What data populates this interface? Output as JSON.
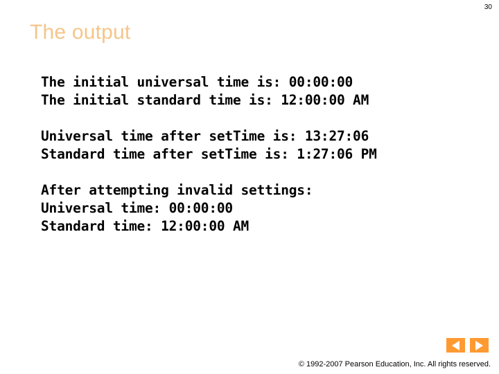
{
  "slide": {
    "number": "30",
    "title": "The output",
    "copyright": "© 1992-2007 Pearson Education, Inc. All rights reserved.",
    "accent_color": "#ff9a33",
    "title_color": "#f5c58a"
  },
  "output": {
    "blocks": [
      {
        "lines": [
          "The initial universal time is: 00:00:00",
          "The initial standard time is: 12:00:00 AM"
        ]
      },
      {
        "lines": [
          "Universal time after setTime is: 13:27:06",
          "Standard time after setTime is: 1:27:06 PM"
        ]
      },
      {
        "lines": [
          "After attempting invalid settings:",
          "Universal time: 00:00:00",
          "Standard time: 12:00:00 AM"
        ]
      }
    ]
  },
  "nav": {
    "prev_label": "prev-arrow",
    "next_label": "next-arrow"
  }
}
